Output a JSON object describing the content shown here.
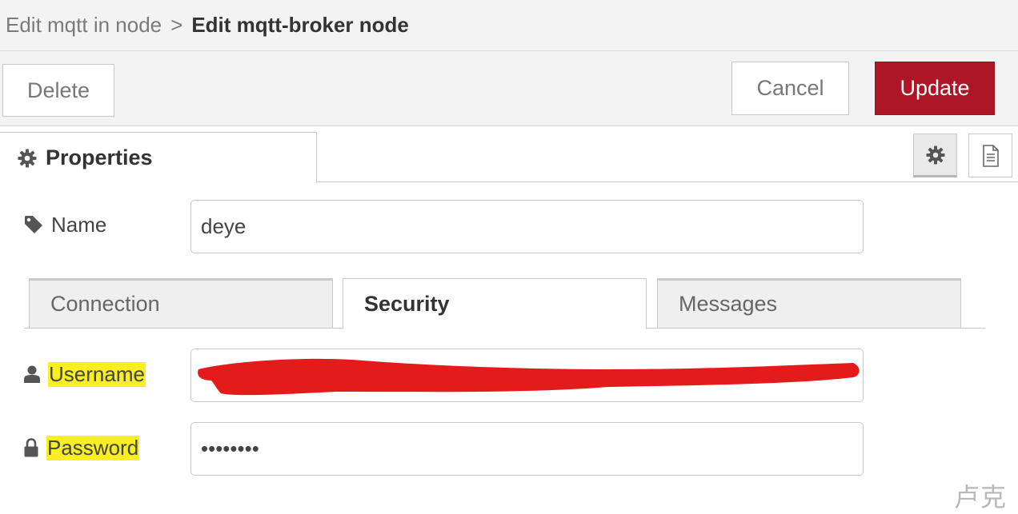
{
  "breadcrumb": {
    "previous": "Edit mqtt in node",
    "separator": ">",
    "current": "Edit mqtt-broker node"
  },
  "toolbar": {
    "delete_label": "Delete",
    "cancel_label": "Cancel",
    "update_label": "Update"
  },
  "tabs": {
    "properties_label": "Properties"
  },
  "side_buttons": [
    "gear-icon",
    "file-text-icon"
  ],
  "name_field": {
    "label": "Name",
    "value": "deye"
  },
  "subtabs": [
    {
      "label": "Connection",
      "active": false
    },
    {
      "label": "Security",
      "active": true
    },
    {
      "label": "Messages",
      "active": false
    }
  ],
  "security": {
    "username_label": "Username",
    "username_value": "",
    "password_label": "Password",
    "password_value": "••••••••"
  },
  "watermark": "卢克",
  "colors": {
    "update_button": "#ad1625",
    "highlight": "#f8ee22",
    "redaction": "#e31b1b"
  }
}
